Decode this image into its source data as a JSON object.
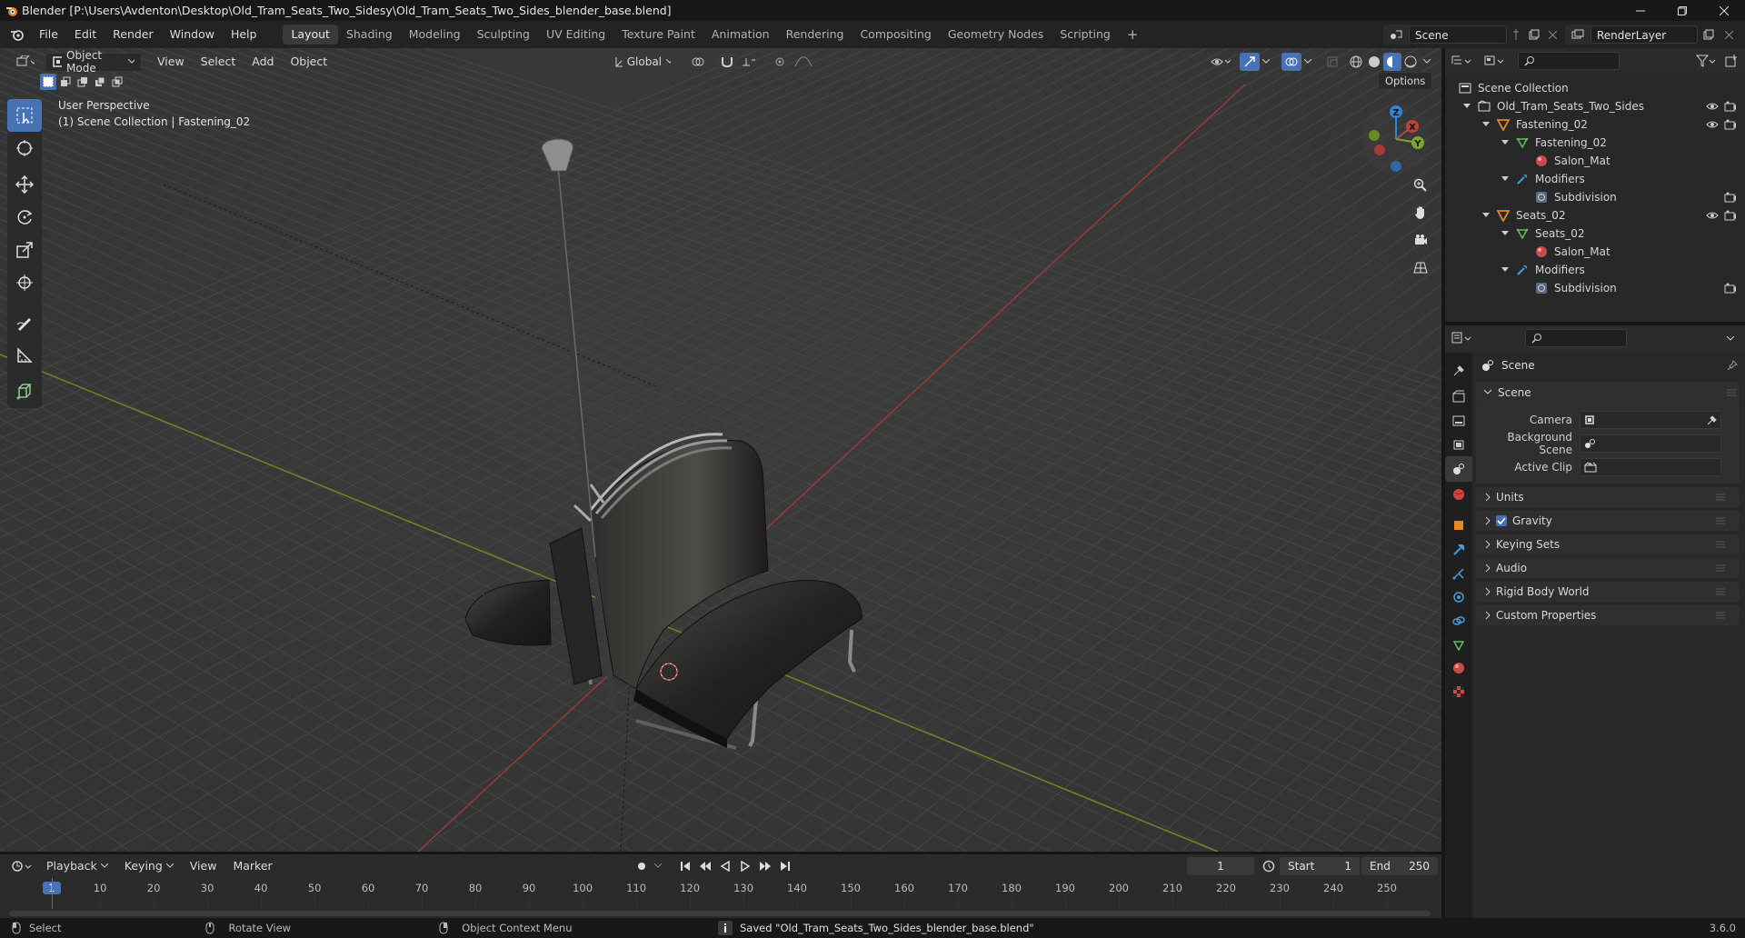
{
  "window": {
    "title": "Blender [P:\\Users\\Avdenton\\Desktop\\Old_Tram_Seats_Two_Sidesy\\Old_Tram_Seats_Two_Sides_blender_base.blend]",
    "controls": [
      "minimize",
      "maximize",
      "close"
    ]
  },
  "menubar": {
    "menus": [
      "File",
      "Edit",
      "Render",
      "Window",
      "Help"
    ],
    "workspaces": [
      "Layout",
      "Shading",
      "Modeling",
      "Sculpting",
      "UV Editing",
      "Texture Paint",
      "Animation",
      "Rendering",
      "Compositing",
      "Geometry Nodes",
      "Scripting"
    ],
    "active_workspace": "Layout",
    "add_workspace": "+",
    "scene": "Scene",
    "view_layer": "RenderLayer"
  },
  "viewport": {
    "mode": "Object Mode",
    "menus": [
      "View",
      "Select",
      "Add",
      "Object"
    ],
    "transform_orientation": "Global",
    "options_label": "Options",
    "perspective_label": "User Perspective",
    "context_label": "(1) Scene Collection | Fastening_02",
    "gizmo_axes": {
      "z": "Z",
      "x": "X",
      "y": "Y"
    }
  },
  "outliner": {
    "search_placeholder": "",
    "rows": [
      {
        "label": "Scene Collection",
        "type": "collection",
        "depth": 0
      },
      {
        "label": "Old_Tram_Seats_Two_Sides",
        "type": "collection",
        "depth": 1
      },
      {
        "label": "Fastening_02",
        "type": "object",
        "depth": 2
      },
      {
        "label": "Fastening_02",
        "type": "mesh",
        "depth": 3
      },
      {
        "label": "Salon_Mat",
        "type": "material",
        "depth": 4
      },
      {
        "label": "Modifiers",
        "type": "modifiers",
        "depth": 3
      },
      {
        "label": "Subdivision",
        "type": "modifier",
        "depth": 4
      },
      {
        "label": "Seats_02",
        "type": "object",
        "depth": 2
      },
      {
        "label": "Seats_02",
        "type": "mesh",
        "depth": 3
      },
      {
        "label": "Salon_Mat",
        "type": "material",
        "depth": 4
      },
      {
        "label": "Modifiers",
        "type": "modifiers",
        "depth": 3
      },
      {
        "label": "Subdivision",
        "type": "modifier",
        "depth": 4
      }
    ]
  },
  "properties": {
    "context": "Scene",
    "panel_title": "Scene",
    "fields": [
      {
        "label": "Camera",
        "value": ""
      },
      {
        "label": "Background Scene",
        "value": ""
      },
      {
        "label": "Active Clip",
        "value": ""
      }
    ],
    "panels": [
      "Units",
      "Gravity",
      "Keying Sets",
      "Audio",
      "Rigid Body World",
      "Custom Properties"
    ],
    "gravity_checked": true
  },
  "timeline": {
    "menus": [
      "Playback",
      "Keying",
      "View",
      "Marker"
    ],
    "current_frame": "1",
    "start_label": "Start",
    "start": "1",
    "end_label": "End",
    "end": "250",
    "ruler_ticks": [
      "1",
      "10",
      "20",
      "30",
      "40",
      "50",
      "60",
      "70",
      "80",
      "90",
      "100",
      "110",
      "120",
      "130",
      "140",
      "150",
      "160",
      "170",
      "180",
      "190",
      "200",
      "210",
      "220",
      "230",
      "240",
      "250"
    ]
  },
  "statusbar": {
    "left": [
      "Select",
      "Rotate View",
      "Object Context Menu"
    ],
    "message": "Saved \"Old_Tram_Seats_Two_Sides_blender_base.blend\"",
    "version": "3.6.0"
  },
  "colors": {
    "accent": "#4772b3",
    "x_axis": "#c0413a",
    "y_axis": "#7ea52a",
    "z_axis": "#2f86d9"
  }
}
